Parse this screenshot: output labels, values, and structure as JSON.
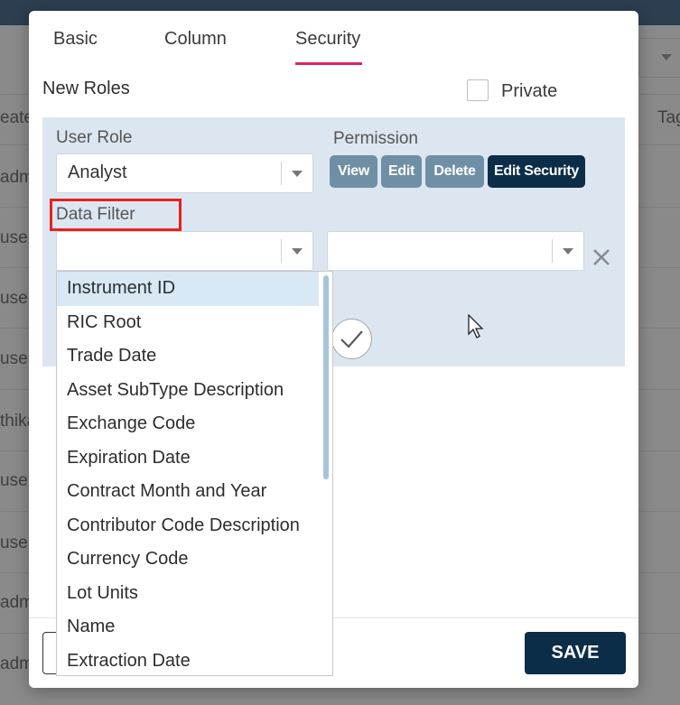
{
  "background": {
    "left_column_texts": [
      "eate",
      "adm",
      "use",
      "use",
      "use",
      "thika",
      "use",
      "use",
      "adm",
      "adm"
    ],
    "right_column_text": "Tag"
  },
  "modal": {
    "tabs": [
      {
        "label": "Basic",
        "active": false
      },
      {
        "label": "Column",
        "active": false
      },
      {
        "label": "Security",
        "active": true
      }
    ],
    "new_roles_label": "New Roles",
    "private_label": "Private",
    "private_checked": false,
    "user_role": {
      "label": "User Role",
      "value": "Analyst"
    },
    "permission": {
      "label": "Permission",
      "buttons": [
        {
          "label": "View",
          "active": false
        },
        {
          "label": "Edit",
          "active": false
        },
        {
          "label": "Delete",
          "active": false
        },
        {
          "label": "Edit Security",
          "active": true
        }
      ]
    },
    "data_filter": {
      "label": "Data Filter",
      "field_value": "",
      "operator_value": ""
    },
    "dropdown_options": [
      "Instrument ID",
      "RIC Root",
      "Trade Date",
      "Asset SubType Description",
      "Exchange Code",
      "Expiration Date",
      "Contract Month and Year",
      "Contributor Code Description",
      "Currency Code",
      "Lot Units",
      "Name",
      "Extraction Date"
    ],
    "dropdown_selected_index": 0,
    "save_label": "SAVE",
    "accent_color": "#e0245e",
    "primary_color": "#0c2d48",
    "highlight_color": "#e8201f"
  }
}
